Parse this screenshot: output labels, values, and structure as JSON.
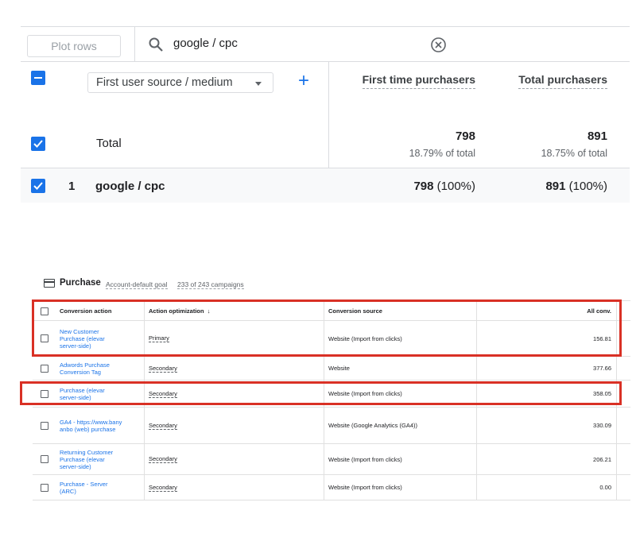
{
  "report": {
    "plot_rows_label": "Plot rows",
    "search_value": "google / cpc",
    "dimension_label": "First user source / medium",
    "columns": [
      "First time purchasers",
      "Total purchasers"
    ],
    "total": {
      "label": "Total",
      "values": [
        "798",
        "891"
      ],
      "percents": [
        "18.79% of total",
        "18.75% of total"
      ]
    },
    "rows": [
      {
        "index": "1",
        "name": "google / cpc",
        "values": [
          "798",
          "891"
        ],
        "shares": [
          "(100%)",
          "(100%)"
        ]
      }
    ],
    "accent_color": "#1a73e8"
  },
  "goal": {
    "title": "Purchase",
    "goal_type": "Account-default goal",
    "campaigns": "233 of 243 campaigns",
    "headers": {
      "action": "Conversion action",
      "optimization": "Action optimization",
      "optimization_sort_icon": "↓",
      "source": "Conversion source",
      "all_conv": "All conv."
    },
    "rows": [
      {
        "action": "New Customer Purchase (elevar server-side)",
        "optimization": "Primary",
        "source": "Website (Import from clicks)",
        "all_conv": "156.81"
      },
      {
        "action": "Adwords Purchase Conversion Tag",
        "optimization": "Secondary",
        "source": "Website",
        "all_conv": "377.66"
      },
      {
        "action": "Purchase (elevar server-side)",
        "optimization": "Secondary",
        "source": "Website (Import from clicks)",
        "all_conv": "358.05"
      },
      {
        "action": "GA4 - https://www.banyanbo (web) purchase",
        "optimization": "Secondary",
        "source": "Website (Google Analytics (GA4))",
        "all_conv": "330.09"
      },
      {
        "action": "Returning Customer Purchase (elevar server-side)",
        "optimization": "Secondary",
        "source": "Website (Import from clicks)",
        "all_conv": "206.21"
      },
      {
        "action": "Purchase - Server (ARC)",
        "optimization": "Secondary",
        "source": "Website (Import from clicks)",
        "all_conv": "0.00"
      }
    ],
    "highlight_color": "#d93025"
  }
}
